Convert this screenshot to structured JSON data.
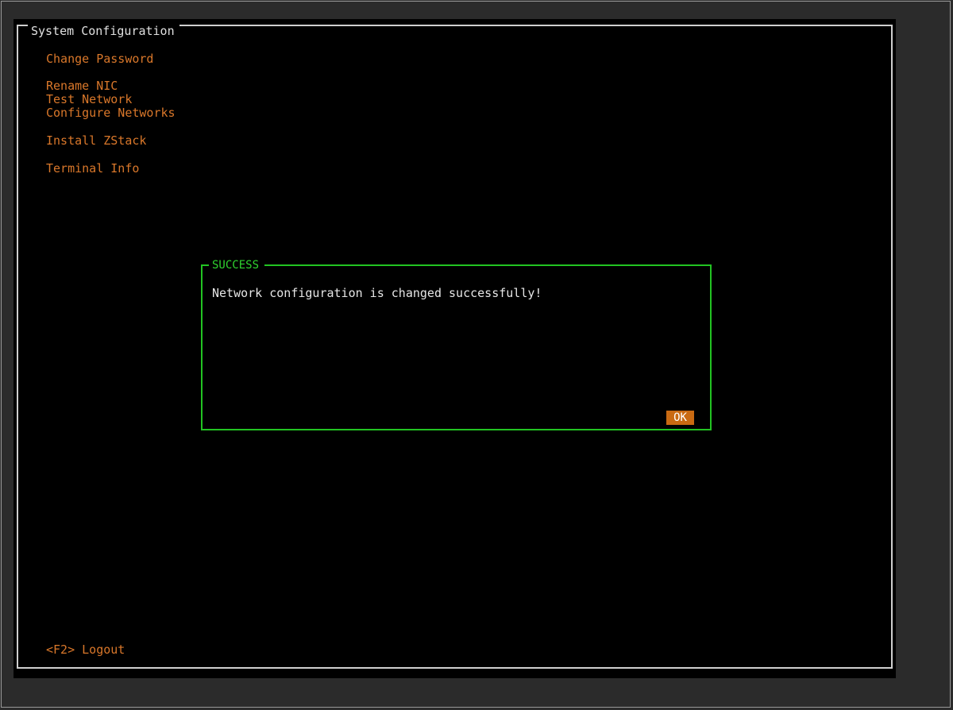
{
  "window": {
    "title": "System Configuration"
  },
  "menu": {
    "items": [
      {
        "label": "Change Password"
      },
      {
        "label": "Rename NIC"
      },
      {
        "label": "Test Network"
      },
      {
        "label": "Configure Networks"
      },
      {
        "label": "Install ZStack"
      },
      {
        "label": "Terminal Info"
      }
    ]
  },
  "footer": {
    "logout_label": "<F2> Logout"
  },
  "dialog": {
    "title": "SUCCESS",
    "message": "Network configuration is changed successfully!",
    "ok_label": "OK"
  },
  "colors": {
    "menu_text": "#d9772a",
    "dialog_border": "#22c322",
    "ok_button_bg": "#c96a12",
    "background": "#000000"
  }
}
